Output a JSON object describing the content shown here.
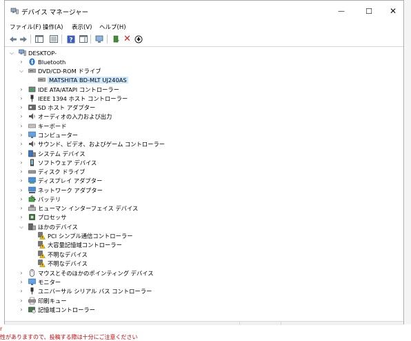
{
  "window": {
    "title": "デバイス マネージャー",
    "controls": {
      "minimize": "—",
      "maximize": "☐",
      "close": "✕"
    }
  },
  "menu": [
    {
      "label": "ファイル(F)"
    },
    {
      "label": "操作(A)"
    },
    {
      "label": "表示(V)"
    },
    {
      "label": "ヘルプ(H)"
    }
  ],
  "toolbar": [
    "back-icon",
    "forward-icon",
    "show-hide-console-tree-icon",
    "properties-icon",
    "help-icon",
    "action-pane-icon",
    "scan-hardware-icon",
    "update-driver-icon",
    "uninstall-icon",
    "disable-device-icon"
  ],
  "tree": {
    "root": "DESKTOP-",
    "bluetooth": "Bluetooth",
    "dvd": "DVD/CD-ROM ドライブ",
    "dvd_device": "MATSHITA BD-MLT UJ240AS",
    "ide": "IDE ATA/ATAPI コントローラー",
    "ieee": "IEEE 1394 ホスト コントローラー",
    "sdhost": "SD ホスト アダプター",
    "audio_io": "オーディオの入力および出力",
    "keyboard": "キーボード",
    "computer": "コンピューター",
    "sound": "サウンド、ビデオ、およびゲーム コントローラー",
    "system": "システム デバイス",
    "software": "ソフトウェア デバイス",
    "disk": "ディスク ドライブ",
    "display": "ディスプレイ アダプター",
    "network": "ネットワーク アダプター",
    "battery": "バッテリ",
    "hid": "ヒューマン インターフェイス デバイス",
    "processor": "プロセッサ",
    "other": "ほかのデバイス",
    "other_pci": "PCI シンプル通信コントローラー",
    "other_storage": "大容量記憶域コントローラー",
    "other_unknown1": "不明なデバイス",
    "other_unknown2": "不明なデバイス",
    "mouse": "マウスとそのほかのポインティング デバイス",
    "monitor": "モニター",
    "usb": "ユニバーサル シリアル バス コントローラー",
    "print": "印刷キュー",
    "storage_ctrl": "記憶域コントローラー"
  },
  "background": {
    "bottom_line1": "r",
    "bottom_line2": "性がありますので、投稿する際は十分にご注意ください"
  },
  "colors": {
    "selection": "#cce8ff",
    "warning": "#f2c200",
    "uninstall_red": "#d32020",
    "background_red": "#cc0000"
  }
}
